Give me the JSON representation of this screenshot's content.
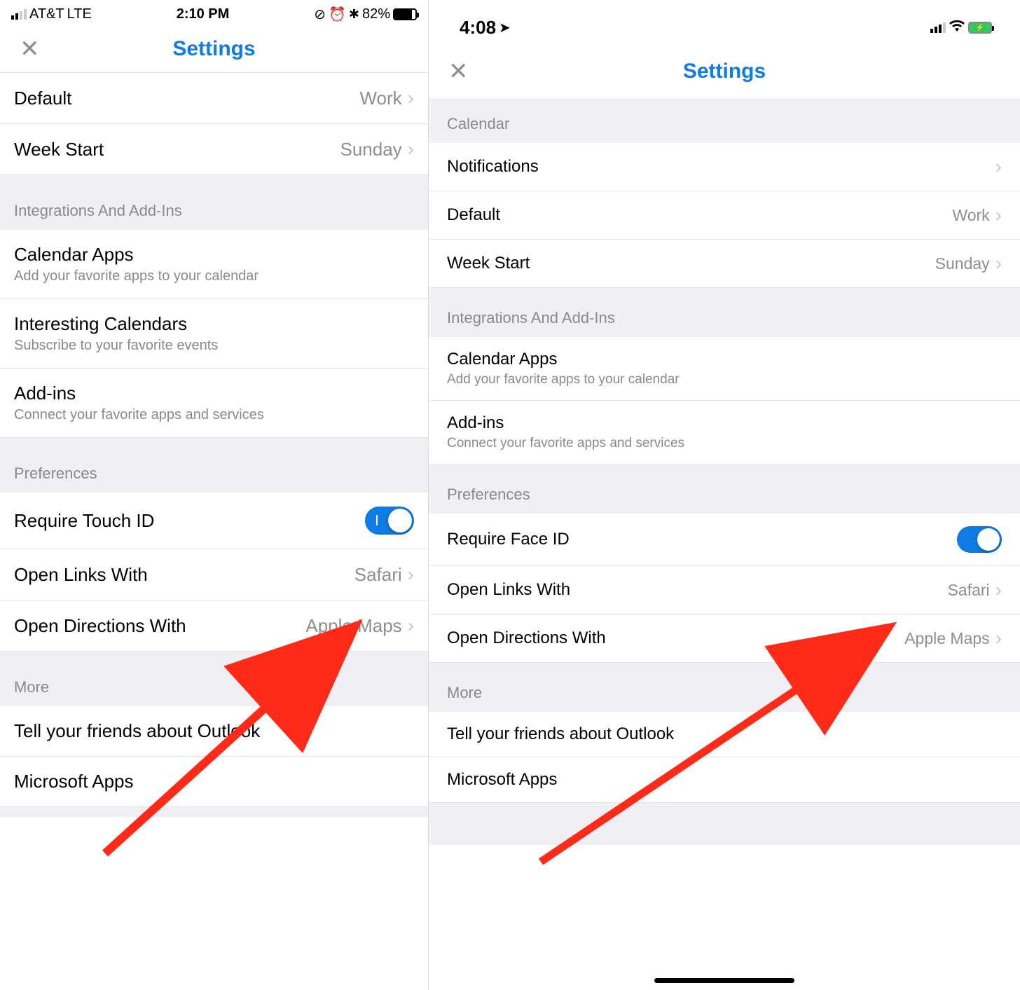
{
  "left": {
    "status": {
      "carrier": "AT&T",
      "network": "LTE",
      "time": "2:10 PM",
      "battery_pct": "82%"
    },
    "nav": {
      "title": "Settings"
    },
    "top_rows": [
      {
        "title": "Default",
        "value": "Work"
      },
      {
        "title": "Week Start",
        "value": "Sunday"
      }
    ],
    "integrations_header": "Integrations And Add-Ins",
    "integrations": [
      {
        "title": "Calendar Apps",
        "subtitle": "Add your favorite apps to your calendar"
      },
      {
        "title": "Interesting Calendars",
        "subtitle": "Subscribe to your favorite events"
      },
      {
        "title": "Add-ins",
        "subtitle": "Connect your favorite apps and services"
      }
    ],
    "preferences_header": "Preferences",
    "preferences": {
      "require_label": "Require Touch ID",
      "open_links_label": "Open Links With",
      "open_links_value": "Safari",
      "open_dirs_label": "Open Directions With",
      "open_dirs_value": "Apple Maps"
    },
    "more_header": "More",
    "more": [
      {
        "title": "Tell your friends about Outlook"
      },
      {
        "title": "Microsoft Apps"
      }
    ]
  },
  "right": {
    "status": {
      "time": "4:08"
    },
    "nav": {
      "title": "Settings"
    },
    "calendar_header": "Calendar",
    "calendar_rows": [
      {
        "title": "Notifications",
        "value": ""
      },
      {
        "title": "Default",
        "value": "Work"
      },
      {
        "title": "Week Start",
        "value": "Sunday"
      }
    ],
    "integrations_header": "Integrations And Add-Ins",
    "integrations": [
      {
        "title": "Calendar Apps",
        "subtitle": "Add your favorite apps to your calendar"
      },
      {
        "title": "Add-ins",
        "subtitle": "Connect your favorite apps and services"
      }
    ],
    "preferences_header": "Preferences",
    "preferences": {
      "require_label": "Require Face ID",
      "open_links_label": "Open Links With",
      "open_links_value": "Safari",
      "open_dirs_label": "Open Directions With",
      "open_dirs_value": "Apple Maps"
    },
    "more_header": "More",
    "more": [
      {
        "title": "Tell your friends about Outlook"
      },
      {
        "title": "Microsoft Apps"
      }
    ]
  }
}
